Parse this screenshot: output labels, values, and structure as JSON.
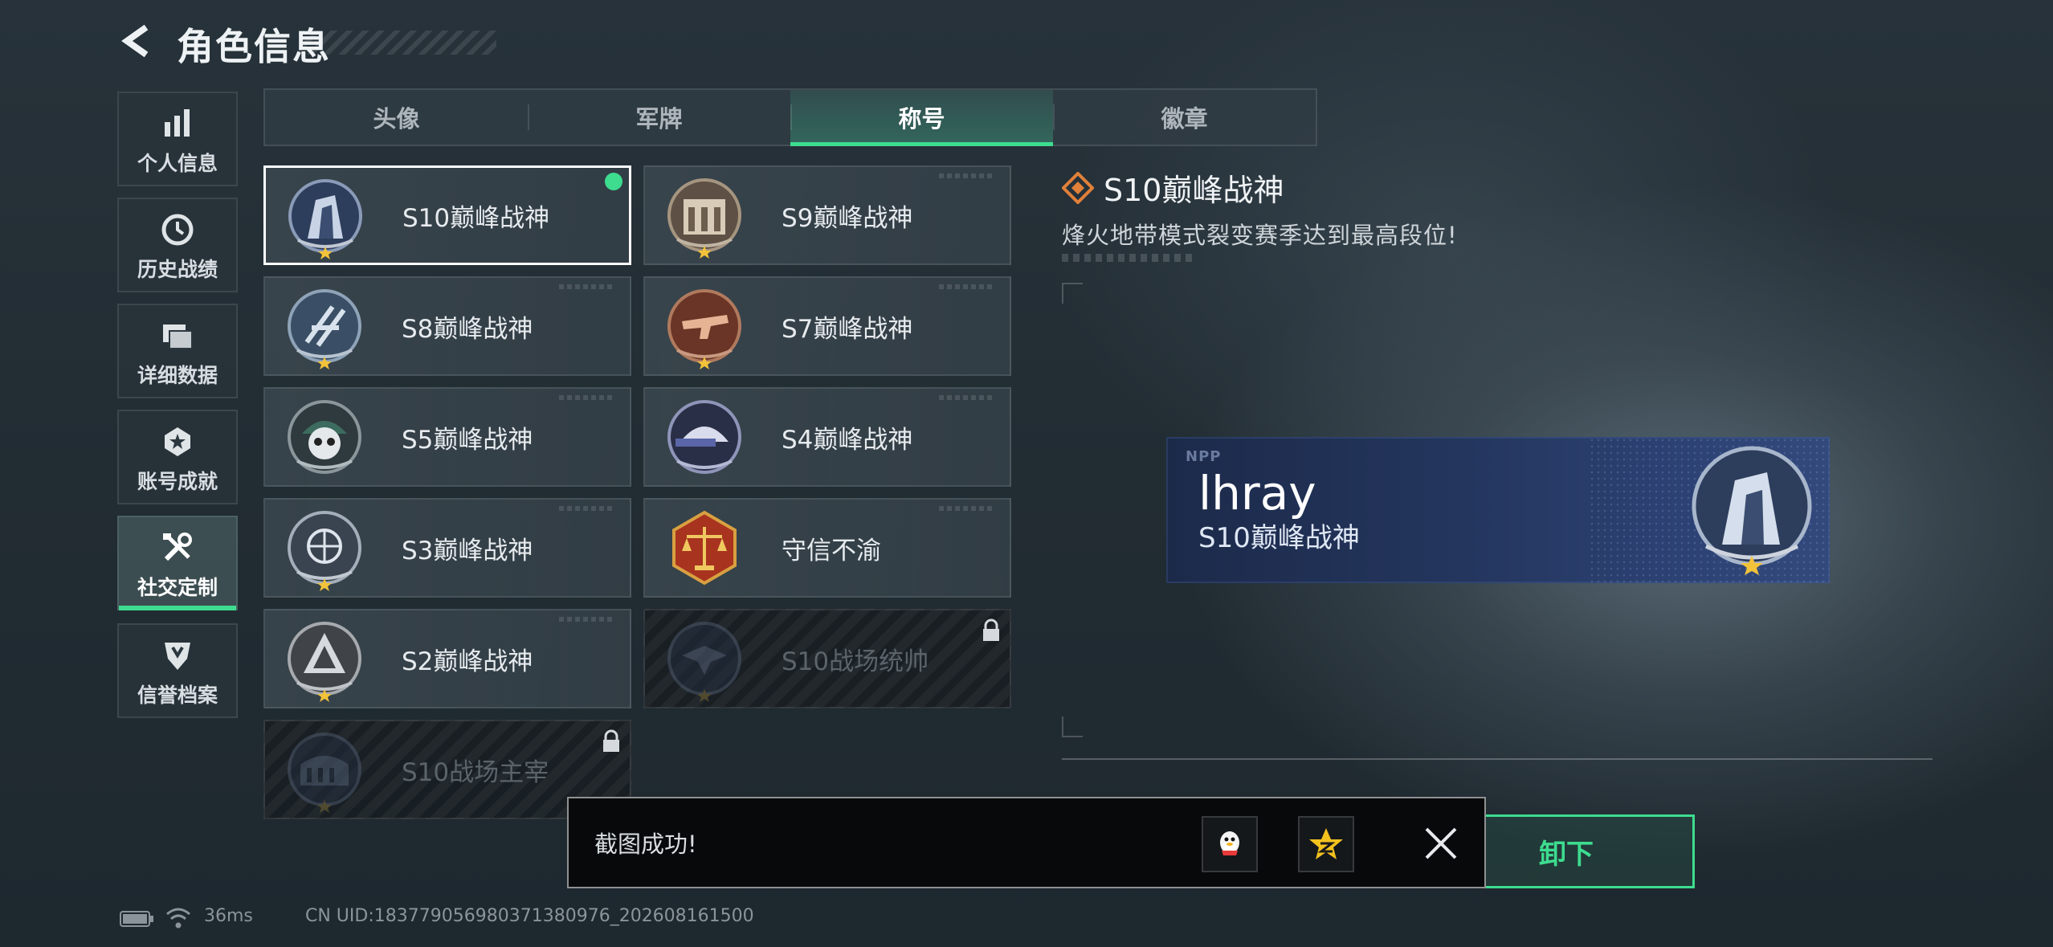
{
  "header": {
    "title": "角色信息"
  },
  "sidebar": {
    "items": [
      {
        "label": "个人信息",
        "icon": "bar-chart-icon"
      },
      {
        "label": "历史战绩",
        "icon": "clock-icon"
      },
      {
        "label": "详细数据",
        "icon": "folder-icon"
      },
      {
        "label": "账号成就",
        "icon": "medal-icon"
      },
      {
        "label": "社交定制",
        "icon": "tools-icon",
        "active": true
      },
      {
        "label": "信誉档案",
        "icon": "shield-icon"
      }
    ]
  },
  "tabs": [
    {
      "label": "头像"
    },
    {
      "label": "军牌"
    },
    {
      "label": "称号",
      "active": true
    },
    {
      "label": "徽章"
    }
  ],
  "titles": [
    {
      "name": "S10巅峰战神",
      "state": "selected"
    },
    {
      "name": "S9巅峰战神",
      "state": "unlocked"
    },
    {
      "name": "S8巅峰战神",
      "state": "unlocked"
    },
    {
      "name": "S7巅峰战神",
      "state": "unlocked"
    },
    {
      "name": "S5巅峰战神",
      "state": "unlocked"
    },
    {
      "name": "S4巅峰战神",
      "state": "unlocked"
    },
    {
      "name": "S3巅峰战神",
      "state": "unlocked"
    },
    {
      "name": "守信不渝",
      "state": "unlocked"
    },
    {
      "name": "S2巅峰战神",
      "state": "unlocked"
    },
    {
      "name": "S10战场统帅",
      "state": "locked"
    },
    {
      "name": "S10战场主宰",
      "state": "locked"
    }
  ],
  "detail": {
    "title": "S10巅峰战神",
    "description": "烽火地带模式裂变赛季达到最高段位!"
  },
  "banner": {
    "logo": "NPP",
    "player_name": "lhray",
    "title": "S10巅峰战神"
  },
  "actions": {
    "unequip_label": "卸下"
  },
  "toast": {
    "message": "截图成功!"
  },
  "status": {
    "ping": "36ms",
    "uid": "CN UID:18377905698037138097​6_202608161500"
  },
  "colors": {
    "accent": "#3ddc8f",
    "selected_border": "#ffffff",
    "banner": "#24365e"
  }
}
